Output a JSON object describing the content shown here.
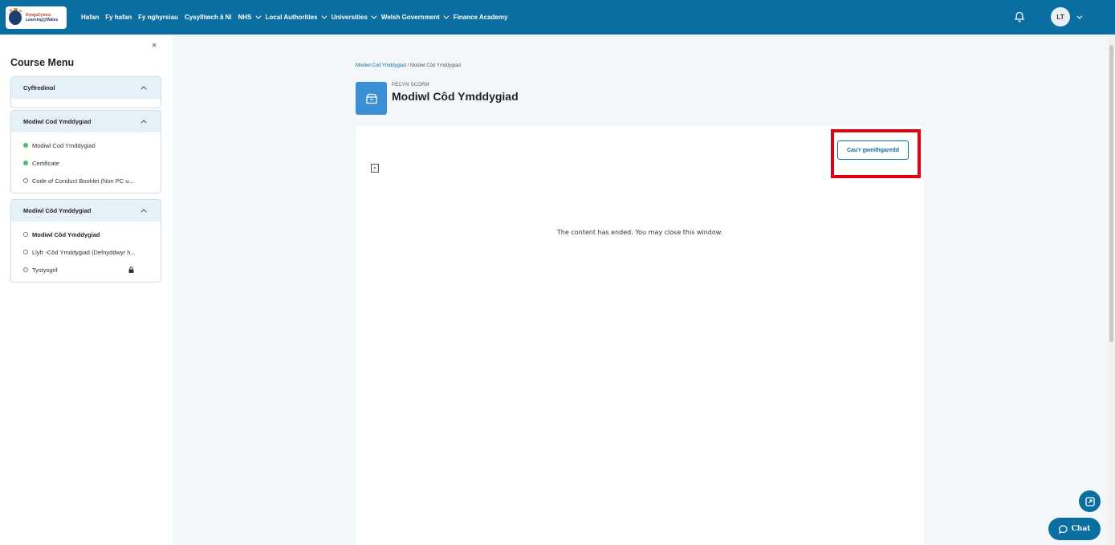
{
  "nav": {
    "logo_line1": "DysguCymru",
    "logo_line2": "Learning@Wales",
    "items": [
      {
        "label": "Hafan",
        "dropdown": false
      },
      {
        "label": "Fy hafan",
        "dropdown": false
      },
      {
        "label": "Fy nghyrsiau",
        "dropdown": false
      },
      {
        "label": "Cysylltwch â Ni",
        "dropdown": false
      },
      {
        "label": "NHS",
        "dropdown": true
      },
      {
        "label": "Local Authorities",
        "dropdown": true
      },
      {
        "label": "Universities",
        "dropdown": true
      },
      {
        "label": "Welsh Government",
        "dropdown": true
      },
      {
        "label": "Finance Academy",
        "dropdown": false
      }
    ],
    "avatar_initials": "LT"
  },
  "sidebar": {
    "close_symbol": "×",
    "title": "Course Menu",
    "sections": [
      {
        "title": "Cyffredinol",
        "items": []
      },
      {
        "title": "Modiwl Cod Ymddygiad",
        "items": [
          {
            "label": "Modiwl Cod Ymddygiad",
            "status": "done"
          },
          {
            "label": "Certificate",
            "status": "done"
          },
          {
            "label": "Code of Conduct Booklet (Non PC u...",
            "status": "open"
          }
        ]
      },
      {
        "title": "Modiwl Côd Ymddygiad",
        "items": [
          {
            "label": "Modiwl Côd Ymddygiad",
            "status": "open",
            "active": true
          },
          {
            "label": "Llyfr -Côd Ymddygiad (Defnyddwyr h...",
            "status": "open"
          },
          {
            "label": "Tystysgrif",
            "status": "open",
            "locked": true
          }
        ]
      }
    ]
  },
  "breadcrumb": {
    "link": "Modiwl Cod Ymddygiad",
    "separator": " / ",
    "current": "Modiwl Côd Ymddygiad"
  },
  "header": {
    "pre_title": "PECYN SCORM",
    "title": "Modiwl Côd Ymddygiad"
  },
  "content": {
    "close_button": "Cau'r gweithgaredd",
    "toggle_symbol": "»",
    "ended_message": "The content has ended. You may close this window."
  },
  "chat": {
    "label": "Chat"
  },
  "colors": {
    "brand": "#0a6fa0",
    "highlight": "#e3000f",
    "done": "#3cc46a"
  }
}
